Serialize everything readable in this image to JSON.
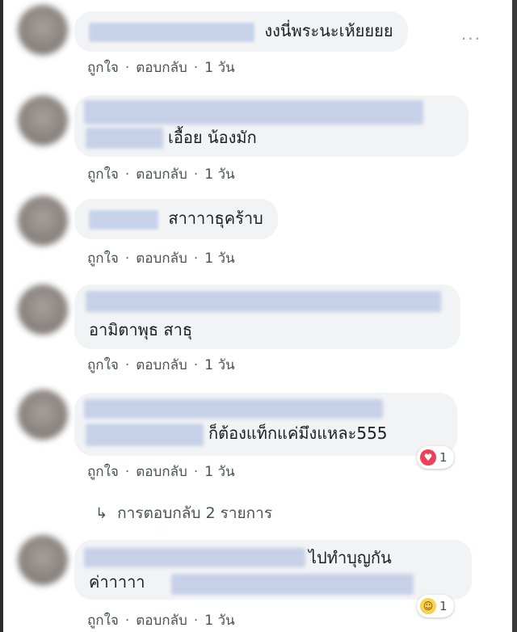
{
  "actions": {
    "like": "ถูกใจ",
    "reply": "ตอบกลับ",
    "separator": "·"
  },
  "comments": [
    {
      "text": "งงนี่พระนะเห้ยยยย",
      "time": "1 วัน"
    },
    {
      "text": "เอื้อย น้องมัก",
      "time": "1 วัน"
    },
    {
      "text": "สาาาาธุคร้าบ",
      "time": "1 วัน"
    },
    {
      "text": "อามิตาพุธ สาธุ",
      "time": "1 วัน"
    },
    {
      "text": "ก็ต้องแท็กแค่มึงแหละ555",
      "time": "1 วัน",
      "reaction": {
        "icon": "heart-icon",
        "count": "1"
      }
    },
    {
      "text1": "ไปทำบุญกัน",
      "text2": "ค่าาาาา",
      "time": "1 วัน",
      "reaction": {
        "icon": "haha-icon",
        "count": "1"
      }
    }
  ],
  "replies_link": {
    "label": "การตอบกลับ 2 รายการ",
    "icon": "reply-arrow-icon"
  },
  "more_menu": {
    "label": "...",
    "icon": "more-dots-icon"
  },
  "colors": {
    "bubble": "#f2f3f5",
    "heart": "#f33e58",
    "haha": "#fcd14d",
    "link": "#385898"
  }
}
